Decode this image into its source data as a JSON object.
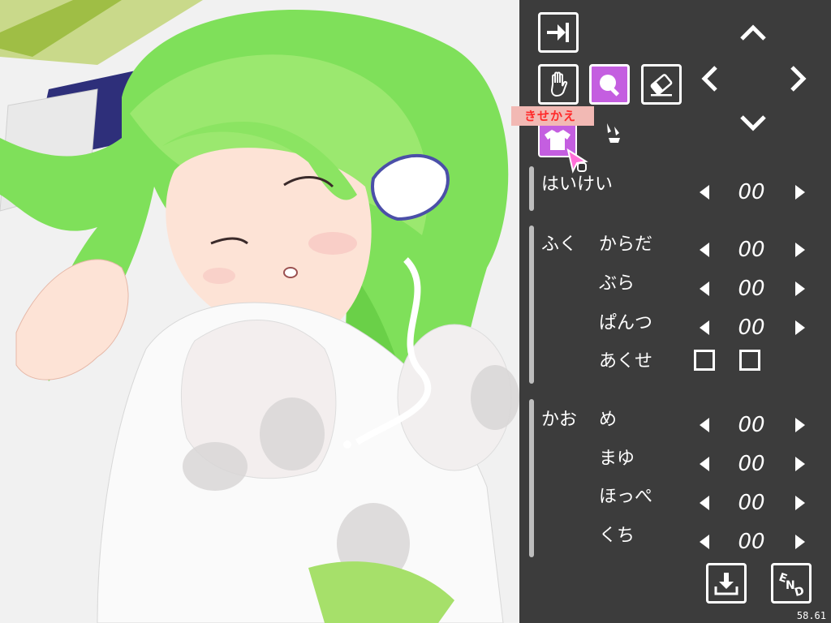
{
  "tooltip": "きせかえ",
  "groups": {
    "background": {
      "label": "はいけい",
      "value": "00"
    },
    "clothes": {
      "label": "ふく",
      "rows": [
        {
          "label": "からだ",
          "value": "00"
        },
        {
          "label": "ぶら",
          "value": "00"
        },
        {
          "label": "ぱんつ",
          "value": "00"
        }
      ],
      "sweat_label": "あくせ"
    },
    "face": {
      "label": "かお",
      "rows": [
        {
          "label": "め",
          "value": "00"
        },
        {
          "label": "まゆ",
          "value": "00"
        },
        {
          "label": "ほっぺ",
          "value": "00"
        },
        {
          "label": "くち",
          "value": "00"
        }
      ]
    }
  },
  "fps": "58.61",
  "icons": {
    "exit": "exit-icon",
    "hand": "hand-icon",
    "magnify": "magnify-icon",
    "eraser": "eraser-icon",
    "dressup": "shirt-icon",
    "save": "download-icon",
    "end": "end-icon"
  },
  "colors": {
    "panel_bg": "#3c3c3c",
    "active_button": "#c45ee0",
    "tooltip_bg": "#f2b9b4",
    "tooltip_text": "#ff2a2a",
    "hair": "#7fe05a"
  }
}
